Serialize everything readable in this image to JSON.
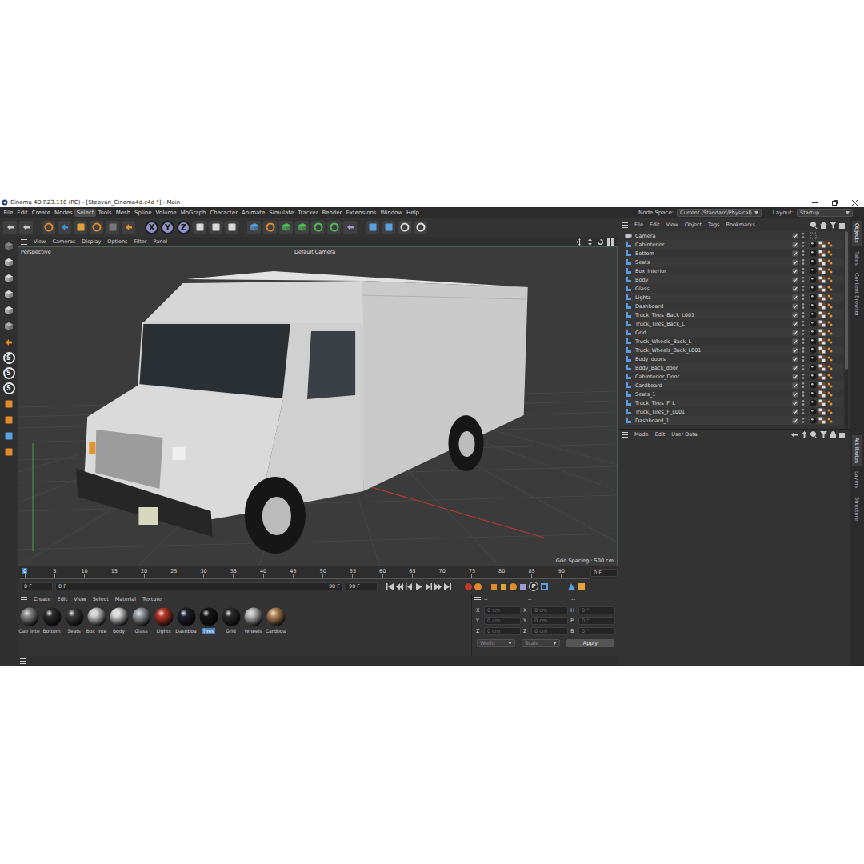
{
  "window": {
    "title": "Cinema 4D R23.110 (RC) - [Stepvan_Cinema4d.c4d *] - Main"
  },
  "menu": [
    {
      "label": "File",
      "selected": false
    },
    {
      "label": "Edit",
      "selected": false
    },
    {
      "label": "Create",
      "selected": false
    },
    {
      "label": "Modes",
      "selected": false
    },
    {
      "label": "Select",
      "selected": true
    },
    {
      "label": "Tools",
      "selected": false
    },
    {
      "label": "Mesh",
      "selected": false
    },
    {
      "label": "Spline",
      "selected": false
    },
    {
      "label": "Volume",
      "selected": false
    },
    {
      "label": "MoGraph",
      "selected": false
    },
    {
      "label": "Character",
      "selected": false
    },
    {
      "label": "Animate",
      "selected": false
    },
    {
      "label": "Simulate",
      "selected": false
    },
    {
      "label": "Tracker",
      "selected": false
    },
    {
      "label": "Render",
      "selected": false
    },
    {
      "label": "Extensions",
      "selected": false
    },
    {
      "label": "Window",
      "selected": false
    },
    {
      "label": "Help",
      "selected": false
    }
  ],
  "node_space": {
    "label": "Node Space:",
    "value": "Current (Standard/Physical)"
  },
  "layout": {
    "label": "Layout:",
    "value": "Startup"
  },
  "toolbar": {
    "axis_buttons": [
      "X",
      "Y",
      "Z"
    ]
  },
  "palette": {
    "snap_labels": [
      "S",
      "S",
      "S"
    ]
  },
  "viewport": {
    "menu": [
      "View",
      "Cameras",
      "Display",
      "Options",
      "Filter",
      "Panel"
    ],
    "view_name": "Perspective",
    "camera": "Default Camera",
    "grid_spacing": "Grid Spacing : 500 cm"
  },
  "timeline": {
    "ticks": [
      {
        "label": "0",
        "current": true
      },
      {
        "label": "5",
        "current": false
      },
      {
        "label": "10",
        "current": false
      },
      {
        "label": "15",
        "current": false
      },
      {
        "label": "20",
        "current": false
      },
      {
        "label": "25",
        "current": false
      },
      {
        "label": "30",
        "current": false
      },
      {
        "label": "35",
        "current": false
      },
      {
        "label": "40",
        "current": false
      },
      {
        "label": "45",
        "current": false
      },
      {
        "label": "50",
        "current": false
      },
      {
        "label": "55",
        "current": false
      },
      {
        "label": "60",
        "current": false
      },
      {
        "label": "65",
        "current": false
      },
      {
        "label": "70",
        "current": false
      },
      {
        "label": "75",
        "current": false
      },
      {
        "label": "80",
        "current": false
      },
      {
        "label": "85",
        "current": false
      },
      {
        "label": "90",
        "current": false
      }
    ],
    "current": "0 F",
    "start": "0 F",
    "range_start": "0 F",
    "range_end": "90 F",
    "end": "90 F",
    "key_button": "P"
  },
  "material_manager": {
    "menu": [
      "Create",
      "Edit",
      "View",
      "Select",
      "Material",
      "Texture"
    ],
    "materials": [
      {
        "name": "Cab_Inte",
        "selected": false,
        "color": "#8c8c8c"
      },
      {
        "name": "Bottom",
        "selected": false,
        "color": "#2e2e2e"
      },
      {
        "name": "Seats",
        "selected": false,
        "color": "#3c3c3c"
      },
      {
        "name": "Box_inte",
        "selected": false,
        "color": "#cfcfcf"
      },
      {
        "name": "Body",
        "selected": false,
        "color": "#dadada"
      },
      {
        "name": "Glass",
        "selected": false,
        "color": "#9aa1a8"
      },
      {
        "name": "Lights",
        "selected": false,
        "color": "#c0392b"
      },
      {
        "name": "Dashboa",
        "selected": false,
        "color": "#1f2230"
      },
      {
        "name": "Tires",
        "selected": true,
        "color": "#161616"
      },
      {
        "name": "Grid",
        "selected": false,
        "color": "#2c2c2c"
      },
      {
        "name": "Wheels",
        "selected": false,
        "color": "#bdbdbd"
      },
      {
        "name": "Cardboa",
        "selected": false,
        "color": "#b98a5a"
      }
    ]
  },
  "coordinates": {
    "headers": [
      "--",
      "--",
      "--"
    ],
    "rows": [
      {
        "axis": "X",
        "position": "0 cm",
        "size_axis": "X",
        "size": "0 cm",
        "rotation_axis": "H",
        "rotation": "0 °"
      },
      {
        "axis": "Y",
        "position": "0 cm",
        "size_axis": "Y",
        "size": "0 cm",
        "rotation_axis": "P",
        "rotation": "0 °"
      },
      {
        "axis": "Z",
        "position": "0 cm",
        "size_axis": "Z",
        "size": "0 cm",
        "rotation_axis": "B",
        "rotation": "0 °"
      }
    ],
    "mode": "World",
    "size_mode": "Scale",
    "apply": "Apply"
  },
  "object_manager": {
    "menu": [
      "File",
      "Edit",
      "View",
      "Object",
      "Tags",
      "Bookmarks"
    ],
    "objects": [
      {
        "name": "Camera",
        "kind": "camera",
        "enabled": true
      },
      {
        "name": "CabInterior",
        "kind": "mesh",
        "enabled": true
      },
      {
        "name": "Bottom",
        "kind": "mesh",
        "enabled": true
      },
      {
        "name": "Seats",
        "kind": "mesh",
        "enabled": true
      },
      {
        "name": "Box_interior",
        "kind": "mesh",
        "enabled": true
      },
      {
        "name": "Body",
        "kind": "mesh",
        "enabled": true
      },
      {
        "name": "Glass",
        "kind": "mesh",
        "enabled": true
      },
      {
        "name": "Lights",
        "kind": "mesh",
        "enabled": true
      },
      {
        "name": "Dashboard",
        "kind": "mesh",
        "enabled": true
      },
      {
        "name": "Truck_Tires_Back_L001",
        "kind": "mesh",
        "enabled": true
      },
      {
        "name": "Truck_Tires_Back_L",
        "kind": "mesh",
        "enabled": true
      },
      {
        "name": "Grid",
        "kind": "mesh",
        "enabled": true
      },
      {
        "name": "Truck_Wheels_Back_L",
        "kind": "mesh",
        "enabled": true
      },
      {
        "name": "Truck_Wheels_Back_L001",
        "kind": "mesh",
        "enabled": true
      },
      {
        "name": "Body_doors",
        "kind": "mesh",
        "enabled": true
      },
      {
        "name": "Body_Back_door",
        "kind": "mesh",
        "enabled": true
      },
      {
        "name": "CabInterior_Door",
        "kind": "mesh",
        "enabled": true
      },
      {
        "name": "Cardboard",
        "kind": "mesh",
        "enabled": true
      },
      {
        "name": "Seats_1",
        "kind": "mesh",
        "enabled": true
      },
      {
        "name": "Truck_Tires_F_L",
        "kind": "mesh",
        "enabled": true
      },
      {
        "name": "Truck_Tires_F_L001",
        "kind": "mesh",
        "enabled": true
      },
      {
        "name": "Dashboard_1",
        "kind": "mesh",
        "enabled": true
      }
    ]
  },
  "attributes": {
    "menu": [
      "Mode",
      "Edit",
      "User Data"
    ]
  },
  "side_tabs": {
    "top": [
      {
        "label": "Objects",
        "selected": true
      },
      {
        "label": "Takes",
        "selected": false
      },
      {
        "label": "Content Browser",
        "selected": false
      }
    ],
    "bottom": [
      {
        "label": "Attributes",
        "selected": true
      },
      {
        "label": "Layers",
        "selected": false
      },
      {
        "label": "Structure",
        "selected": false
      }
    ]
  }
}
